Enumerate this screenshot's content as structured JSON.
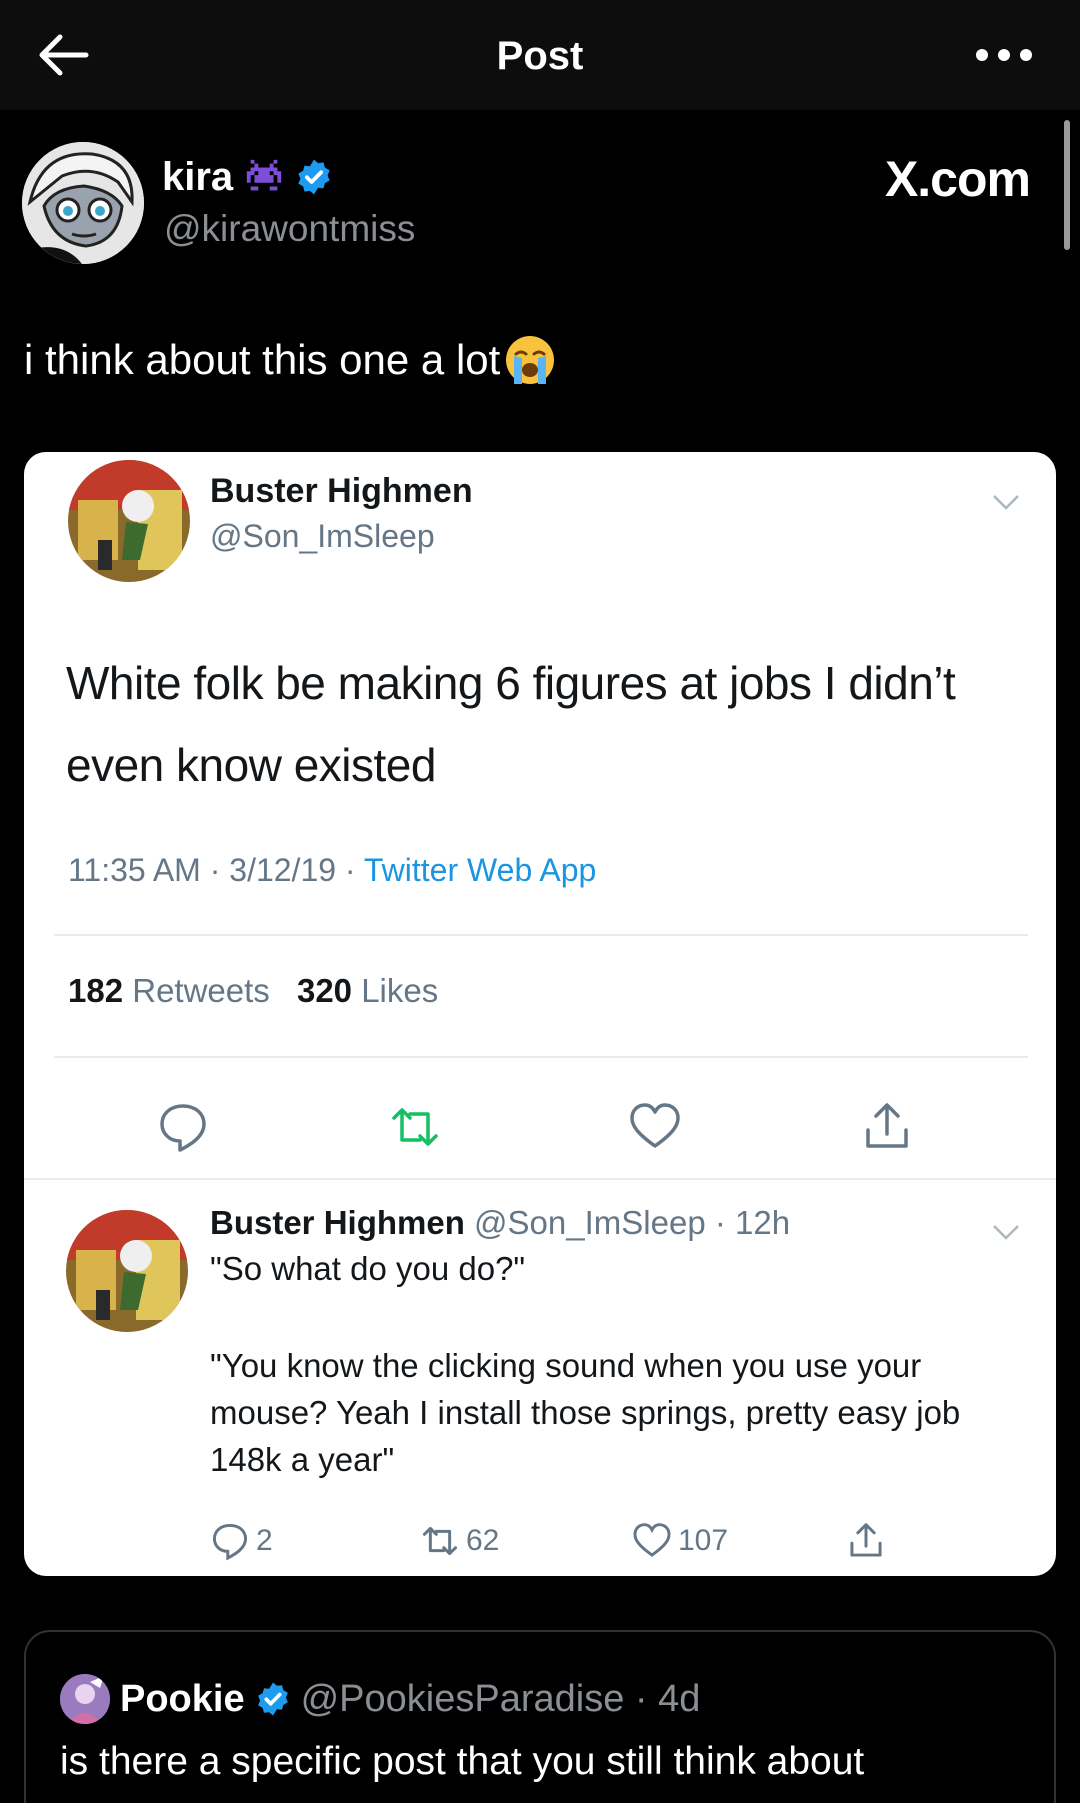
{
  "nav": {
    "title": "Post"
  },
  "author": {
    "name": "kira",
    "handle": "@kirawontmiss",
    "brand": "X.com"
  },
  "post": {
    "text": "i think about this one a lot"
  },
  "screenshot": {
    "name": "Buster Highmen",
    "handle": "@Son_ImSleep",
    "text": "White folk be making 6 figures at jobs I didn’t even know existed",
    "meta_time": "11:35 AM · 3/12/19 · ",
    "meta_source": "Twitter Web App",
    "retweets_count": "182",
    "retweets_label": "Retweets",
    "likes_count": "320",
    "likes_label": "Likes",
    "reply": {
      "name": "Buster Highmen",
      "handle_time": "@Son_ImSleep · 12h",
      "line1": "\"So what do you do?\"",
      "body": "\"You know the clicking sound when you use your mouse? Yeah I install those springs, pretty easy job 148k a year\"",
      "replies": "2",
      "retweets": "62",
      "likes": "107"
    },
    "colors": {
      "retweet_green": "#17bf63",
      "link_blue": "#1b95e0"
    }
  },
  "quote": {
    "name": "Pookie",
    "handle_time": "@PookiesParadise · 4d",
    "text": "is there a specific post that you still think about"
  },
  "colors": {
    "verified_blue": "#1d9bf0",
    "background": "#000000"
  }
}
